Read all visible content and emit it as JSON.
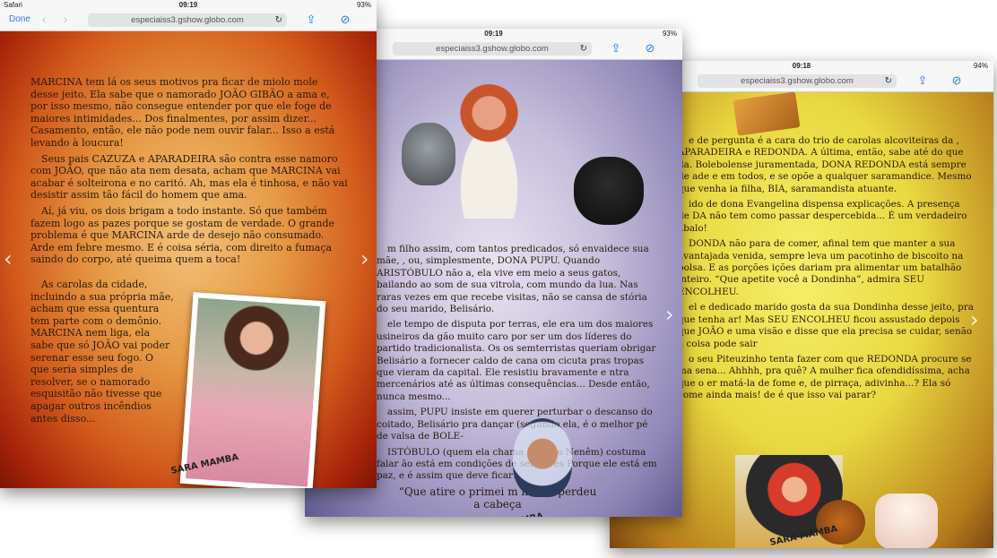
{
  "screen1": {
    "status_carrier": "Safari",
    "status_time": "09:19",
    "status_battery": "93%",
    "done_label": "Done",
    "url": "especiaiss3.gshow.globo.com",
    "paragraphs": [
      "MARCINA tem lá os seus motivos pra ficar de miolo mole desse jeito. Ela sabe que o namorado JOÃO GIBÃO a ama e, por isso mesmo, não consegue entender por que ele foge de maiores intimidades... Dos finalmentes, por assim dizer... Casamento, então, ele não pode nem ouvir falar... Isso a está levando à loucura!",
      "Seus pais CAZUZA e APARADEIRA são contra esse namoro com JOÃO, que não ata nem desata, acham que MARCINA vai acabar é solteirona e no caritó. Ah, mas ela é tinhosa, e não vai desistir assim tão fácil do homem que ama.",
      "Aí, já viu, os dois brigam a todo instante. Só que também fazem logo as pazes porque se gostam de verdade. O grande problema é que MARCINA arde de desejo não consumado. Arde em febre mesmo. E é coisa séria, com direito a fumaça saindo do corpo, até queima quem a toca!",
      "As carolas da cidade, incluindo a sua própria mãe, acham que essa quentura tem parte com o demônio. MARCINA nem liga, ela sabe que só JOÃO vai poder serenar esse seu fogo. O que seria simples de resolver, se o namorado esquisitão não tivesse que apagar outros incêndios antes disso..."
    ]
  },
  "screen2": {
    "status_time": "09:19",
    "status_battery": "93%",
    "url": "especiaiss3.gshow.globo.com",
    "paragraphs": [
      "m filho assim, com tantos predicados, só envaidece sua mãe, , ou, simplesmente, DONA PUPU. Quando ARISTÓBULO não a, ela vive em meio a seus gatos, bailando ao som de sua vitrola, com mundo da lua. Nas raras vezes em que recebe visitas, não se cansa de stória do seu marido, Belisário.",
      "ele tempo de disputa por terras, ele era um dos maiores usineiros da gão muito caro por ser um dos líderes do partido tradicionalista. Os os semterristas queriam obrigar Belisário a fornecer caldo de cana om cicuta pras tropas que vieram da capital. Ele resistiu bravamente e ntra mercenários até as últimas consequências... Desde então, nunca mesmo...",
      "assim, PUPU insiste em querer perturbar o descanso do coitado, Belisário pra dançar (segundo ela, é o melhor pé de valsa de BOLE-",
      "ISTÓBULO (quem ela chama carinho Nenêm) costuma falar ão está em condições de ser apres Porque ele está em paz, e é assim que deve ficar!"
    ],
    "quote": "“Que atire o primei m nunca perdeu a cabeça"
  },
  "screen3": {
    "status_time": "09:18",
    "status_battery": "94%",
    "url": "especiaiss3.gshow.globo.com",
    "paragraphs": [
      "e de pergunta é a cara do trio de carolas alcoviteiras da , APARADEIRA e REDONDA. A última, então, sabe até do que da. Bolebolense juramentada, DONA REDONDA está sempre de ade e em todos, e se opõe a qualquer saramandice. Mesmo que venha ia filha, BIA, saramandista atuante.",
      "ido de dona Evangelina dispensa explicações. A presença de DA não tem como passar despercebida... É um verdadeiro abalo!",
      "DONDA não para de comer, afinal tem que manter a sua avantajada venida, sempre leva um pacotinho de biscoito na bolsa. E as porções ições dariam pra alimentar um batalhão inteiro. “Que apetite você a Dondinha”, admira SEU ENCOLHEU.",
      "el e dedicado marido gosta da sua Dondinha desse jeito, pra que tenha ar! Mas SEU ENCOLHEU ficou assustado depois que JOÃO e uma visão e disse que ela precisa se cuidar, senão a coisa pode sair",
      "o seu Piteuzinho tenta fazer com que REDONDA procure se ma sena... Ahhhh, pra quê? A mulher fica ofendidíssima, acha que o er matá-la de fome e, de pirraça, adivinha...? Ela só come ainda mais! de é que isso vai parar?"
    ]
  },
  "logo_text": "SARA MAMBA"
}
